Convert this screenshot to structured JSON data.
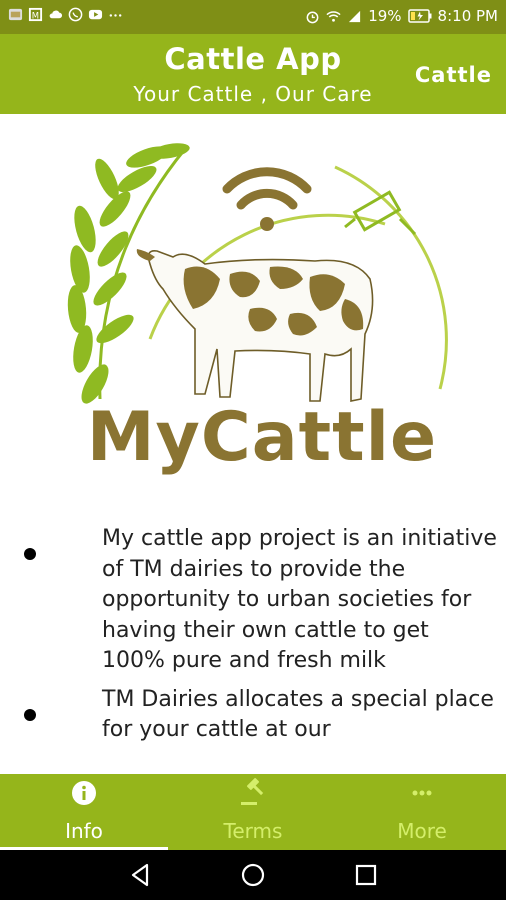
{
  "status_bar": {
    "battery": "19%",
    "time": "8:10 PM",
    "left_icons": [
      "gallery-icon",
      "image-icon",
      "cloud-icon",
      "whatsapp-icon",
      "youtube-icon",
      "more-dots-icon"
    ],
    "right_icons": [
      "alarm-icon",
      "wifi-icon",
      "signal-icon",
      "battery-icon"
    ]
  },
  "app_bar": {
    "title": "Cattle App",
    "subtitle": "Your Cattle , Our Care",
    "action": "Cattle"
  },
  "logo": {
    "brand": "MyCattle",
    "colors": {
      "leaf": "#8fba22",
      "brand": "#8a7432",
      "cow_spots": "#8a7432"
    }
  },
  "content": {
    "bullets": [
      "My cattle app project is an initiative of TM dairies to provide the opportunity to urban societies for having their own cattle to get 100% pure and fresh milk",
      "TM Dairies allocates a special place for your cattle at our"
    ]
  },
  "bottom_nav": {
    "items": [
      {
        "label": "Info",
        "icon": "info-icon",
        "active": true
      },
      {
        "label": "Terms",
        "icon": "gavel-icon",
        "active": false
      },
      {
        "label": "More",
        "icon": "more-horizontal-icon",
        "active": false
      }
    ]
  },
  "colors": {
    "status_bar": "#7f8f16",
    "app_bar": "#95b51b",
    "nav_inactive": "#d4ee6a",
    "nav_active": "#ffffff"
  }
}
